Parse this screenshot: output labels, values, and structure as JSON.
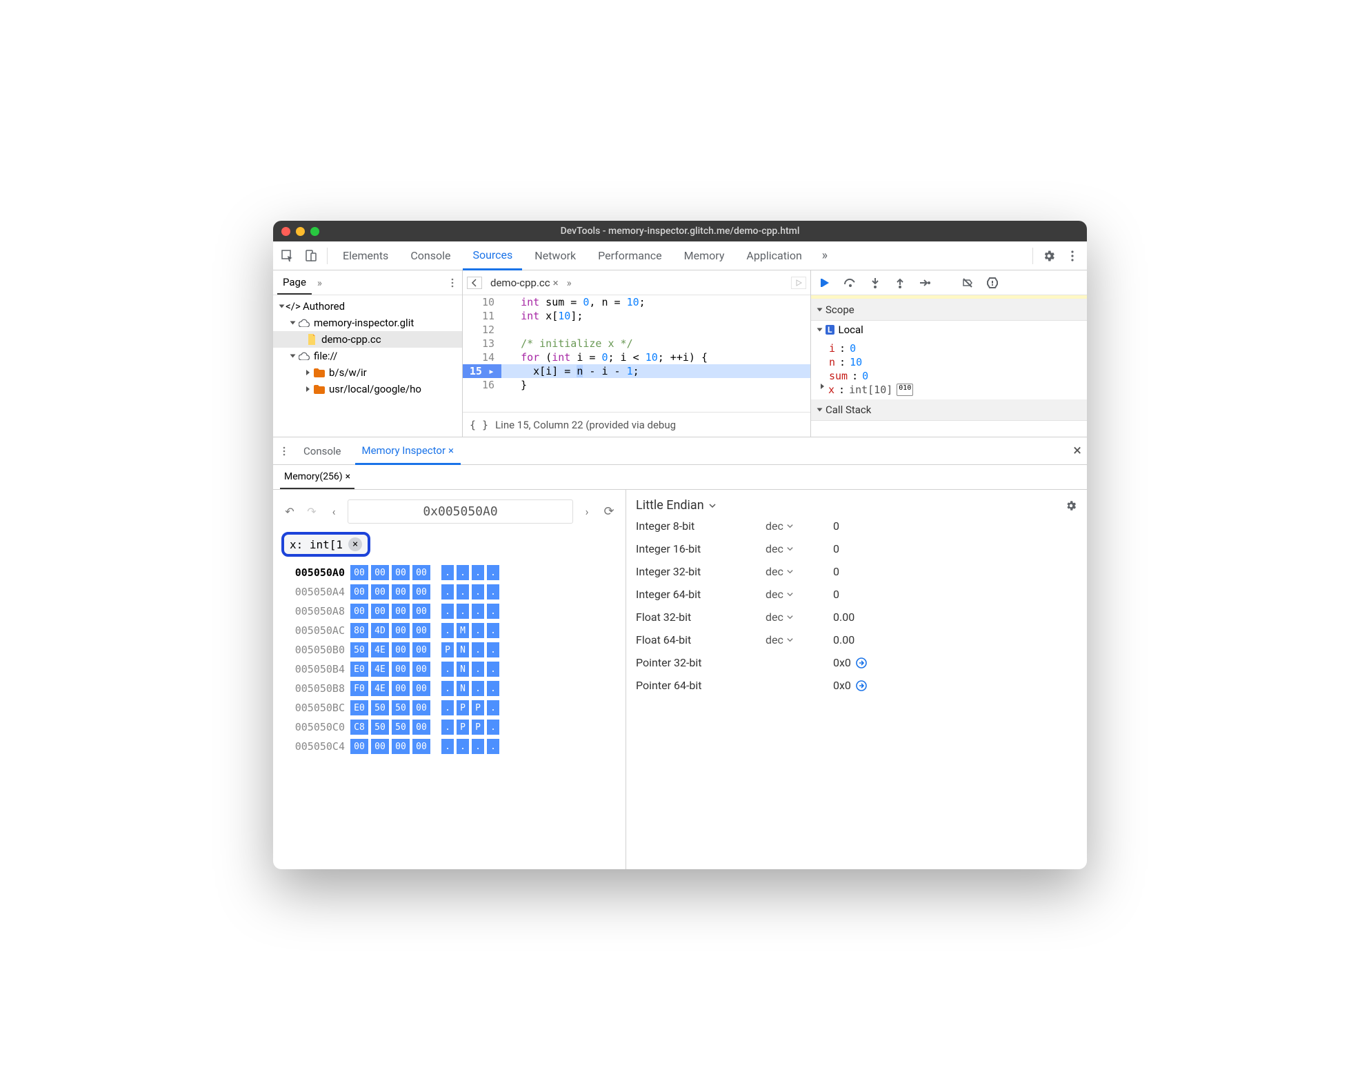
{
  "window_title": "DevTools - memory-inspector.glitch.me/demo-cpp.html",
  "main_tabs": [
    "Elements",
    "Console",
    "Sources",
    "Network",
    "Performance",
    "Memory",
    "Application"
  ],
  "main_tabs_active": "Sources",
  "left": {
    "tab": "Page",
    "nodes": {
      "authored": "Authored",
      "site": "memory-inspector.glit",
      "file": "demo-cpp.cc",
      "file_scheme": "file://",
      "dir1": "b/s/w/ir",
      "dir2": "usr/local/google/ho"
    }
  },
  "editor": {
    "tab_label": "demo-cpp.cc",
    "lines": {
      "10": "int sum = 0, n = 10;",
      "11": "int x[10];",
      "12": "",
      "13": "/* initialize x */",
      "14": "for (int i = 0; i < 10; ++i) {",
      "15": "  x[i] = n - i - 1;",
      "16": "}"
    },
    "status": "Line 15, Column 22 (provided via debug"
  },
  "debugger": {
    "scope_title": "Scope",
    "local_label": "Local",
    "vars": {
      "i": {
        "name": "i",
        "value": "0"
      },
      "n": {
        "name": "n",
        "value": "10"
      },
      "sum": {
        "name": "sum",
        "value": "0"
      },
      "x": {
        "name": "x",
        "type": "int[10]"
      }
    },
    "callstack_title": "Call Stack"
  },
  "drawer": {
    "console_tab": "Console",
    "mi_tab": "Memory Inspector",
    "mem_tab": "Memory(256)"
  },
  "memory": {
    "address": "0x005050A0",
    "chip": "x: int[1",
    "endian": "Little Endian",
    "rows": [
      {
        "addr": "005050A0",
        "bytes": [
          "00",
          "00",
          "00",
          "00"
        ],
        "ascii": [
          ".",
          ".",
          ".",
          "."
        ]
      },
      {
        "addr": "005050A4",
        "bytes": [
          "00",
          "00",
          "00",
          "00"
        ],
        "ascii": [
          ".",
          ".",
          ".",
          "."
        ]
      },
      {
        "addr": "005050A8",
        "bytes": [
          "00",
          "00",
          "00",
          "00"
        ],
        "ascii": [
          ".",
          ".",
          ".",
          "."
        ]
      },
      {
        "addr": "005050AC",
        "bytes": [
          "80",
          "4D",
          "00",
          "00"
        ],
        "ascii": [
          ".",
          "M",
          ".",
          "."
        ]
      },
      {
        "addr": "005050B0",
        "bytes": [
          "50",
          "4E",
          "00",
          "00"
        ],
        "ascii": [
          "P",
          "N",
          ".",
          "."
        ]
      },
      {
        "addr": "005050B4",
        "bytes": [
          "E0",
          "4E",
          "00",
          "00"
        ],
        "ascii": [
          ".",
          "N",
          ".",
          "."
        ]
      },
      {
        "addr": "005050B8",
        "bytes": [
          "F0",
          "4E",
          "00",
          "00"
        ],
        "ascii": [
          ".",
          "N",
          ".",
          "."
        ]
      },
      {
        "addr": "005050BC",
        "bytes": [
          "E0",
          "50",
          "50",
          "00"
        ],
        "ascii": [
          ".",
          "P",
          "P",
          "."
        ]
      },
      {
        "addr": "005050C0",
        "bytes": [
          "C8",
          "50",
          "50",
          "00"
        ],
        "ascii": [
          ".",
          "P",
          "P",
          "."
        ]
      },
      {
        "addr": "005050C4",
        "bytes": [
          "00",
          "00",
          "00",
          "00"
        ],
        "ascii": [
          ".",
          ".",
          ".",
          "."
        ]
      }
    ],
    "values": [
      {
        "label": "Integer 8-bit",
        "fmt": "dec",
        "value": "0"
      },
      {
        "label": "Integer 16-bit",
        "fmt": "dec",
        "value": "0"
      },
      {
        "label": "Integer 32-bit",
        "fmt": "dec",
        "value": "0"
      },
      {
        "label": "Integer 64-bit",
        "fmt": "dec",
        "value": "0"
      },
      {
        "label": "Float 32-bit",
        "fmt": "dec",
        "value": "0.00"
      },
      {
        "label": "Float 64-bit",
        "fmt": "dec",
        "value": "0.00"
      },
      {
        "label": "Pointer 32-bit",
        "fmt": "",
        "value": "0x0",
        "ptr": true
      },
      {
        "label": "Pointer 64-bit",
        "fmt": "",
        "value": "0x0",
        "ptr": true
      }
    ]
  }
}
